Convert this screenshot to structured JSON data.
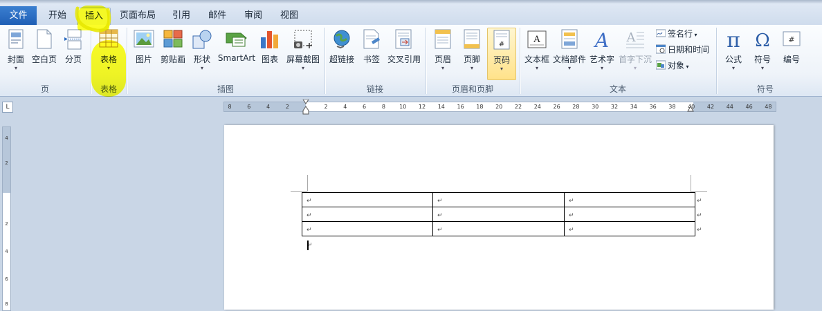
{
  "tabs": {
    "file": "文件",
    "items": [
      "开始",
      "插入",
      "页面布局",
      "引用",
      "邮件",
      "审阅",
      "视图"
    ],
    "active": "插入"
  },
  "ribbon": {
    "groups": {
      "page": {
        "label": "页",
        "buttons": {
          "cover": "封面",
          "blank_page": "空白页",
          "page_break": "分页"
        }
      },
      "table": {
        "label": "表格",
        "buttons": {
          "table": "表格"
        }
      },
      "illustrations": {
        "label": "插图",
        "buttons": {
          "picture": "图片",
          "clipart": "剪贴画",
          "shapes": "形状",
          "smartart": "SmartArt",
          "chart": "图表",
          "screenshot": "屏幕截图"
        }
      },
      "links": {
        "label": "链接",
        "buttons": {
          "hyperlink": "超链接",
          "bookmark": "书签",
          "cross_reference": "交叉引用"
        }
      },
      "header_footer": {
        "label": "页眉和页脚",
        "buttons": {
          "header": "页眉",
          "footer": "页脚",
          "page_number": "页码"
        }
      },
      "text": {
        "label": "文本",
        "buttons": {
          "text_box": "文本框",
          "quick_parts": "文档部件",
          "wordart": "艺术字",
          "drop_cap": "首字下沉"
        },
        "small": {
          "signature_line": "签名行",
          "date_time": "日期和时间",
          "object": "对象"
        }
      },
      "symbols": {
        "label": "符号",
        "buttons": {
          "equation": "公式",
          "symbol": "符号",
          "numbering": "编号"
        }
      }
    },
    "highlight_color": "#ffff00"
  },
  "ruler": {
    "numbers": [
      "8",
      "6",
      "4",
      "2",
      "2",
      "4",
      "6",
      "8",
      "10",
      "12",
      "14",
      "16",
      "18",
      "20",
      "22",
      "24",
      "26",
      "28",
      "30",
      "32",
      "34",
      "36",
      "38",
      "40",
      "42",
      "44",
      "46",
      "48"
    ],
    "vertical_numbers": [
      "4",
      "2",
      "2",
      "4",
      "6",
      "8"
    ],
    "tab_selector": "L"
  },
  "document": {
    "table": {
      "rows": 3,
      "cols": 3
    },
    "paragraph_mark": "↵"
  }
}
